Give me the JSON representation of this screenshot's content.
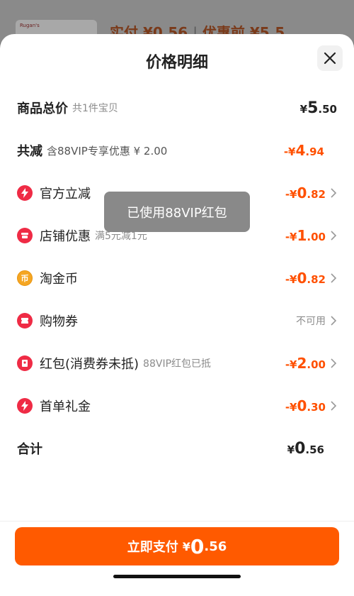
{
  "background": {
    "thumb_brand": "Rugan's",
    "summary_text": "实付 ¥0.56",
    "separator": "|",
    "promo_text": "优惠前 ¥5.5"
  },
  "sheet": {
    "title": "价格明细"
  },
  "rows": {
    "total": {
      "label": "商品总价",
      "sub": "共1件宝贝",
      "cur": "¥",
      "int": "5",
      "dec": ".50"
    },
    "reduce": {
      "label": "共减",
      "sub": "含88VIP专享优惠 ¥ 2.00",
      "cur": "-¥",
      "int": "4",
      "dec": ".94"
    },
    "official": {
      "label": "官方立减",
      "cur": "-¥",
      "int": "0",
      "dec": ".82",
      "icon": "lightning-icon"
    },
    "store": {
      "label": "店铺优惠",
      "sub": "满5元减1元",
      "cur": "-¥",
      "int": "1",
      "dec": ".00",
      "icon": "store-icon"
    },
    "coins": {
      "label": "淘金币",
      "cur": "-¥",
      "int": "0",
      "dec": ".82",
      "icon": "coin-icon",
      "icon_char": "币"
    },
    "coupon": {
      "label": "购物券",
      "value": "不可用",
      "icon": "ticket-icon"
    },
    "redpacket": {
      "label": "红包(消费券未抵)",
      "sub": "88VIP红包已抵",
      "cur": "-¥",
      "int": "2",
      "dec": ".00",
      "icon": "red-packet-icon"
    },
    "firstorder": {
      "label": "首单礼金",
      "cur": "-¥",
      "int": "0",
      "dec": ".30",
      "icon": "lightning-icon"
    },
    "sum": {
      "label": "合计",
      "cur": "¥",
      "int": "0",
      "dec": ".56"
    }
  },
  "toast": {
    "text": "已使用88VIP红包"
  },
  "pay": {
    "label": "立即支付",
    "cur": "¥",
    "int": "0",
    "dec": ".56"
  },
  "colors": {
    "accent": "#ff5000",
    "button": "#ff5a00",
    "icon_red": "#ef2b45",
    "icon_gold": "#f5a623"
  }
}
